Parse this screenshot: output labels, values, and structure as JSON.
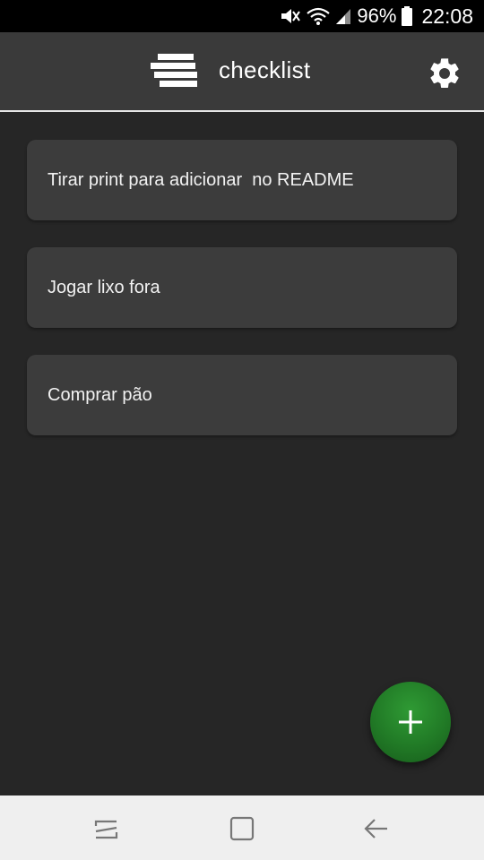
{
  "status_bar": {
    "battery": "96%",
    "time": "22:08",
    "icons": [
      "mute-icon",
      "wifi-icon",
      "signal-icon",
      "battery-icon"
    ]
  },
  "app_bar": {
    "title": "checklist",
    "logo_icon": "stacked-lines-logo",
    "settings_icon": "gear-icon"
  },
  "tasks": [
    {
      "label": "Tirar print para adicionar  no README"
    },
    {
      "label": "Jogar lixo fora"
    },
    {
      "label": "Comprar pão"
    }
  ],
  "fab": {
    "icon": "plus-icon",
    "color": "#217a26"
  },
  "nav_bar": {
    "buttons": [
      "recent-apps-icon",
      "home-icon",
      "back-icon"
    ]
  },
  "colors": {
    "background": "#262626",
    "app_bar": "#3a3a3a",
    "card": "#3c3c3c",
    "accent": "#217a26"
  }
}
